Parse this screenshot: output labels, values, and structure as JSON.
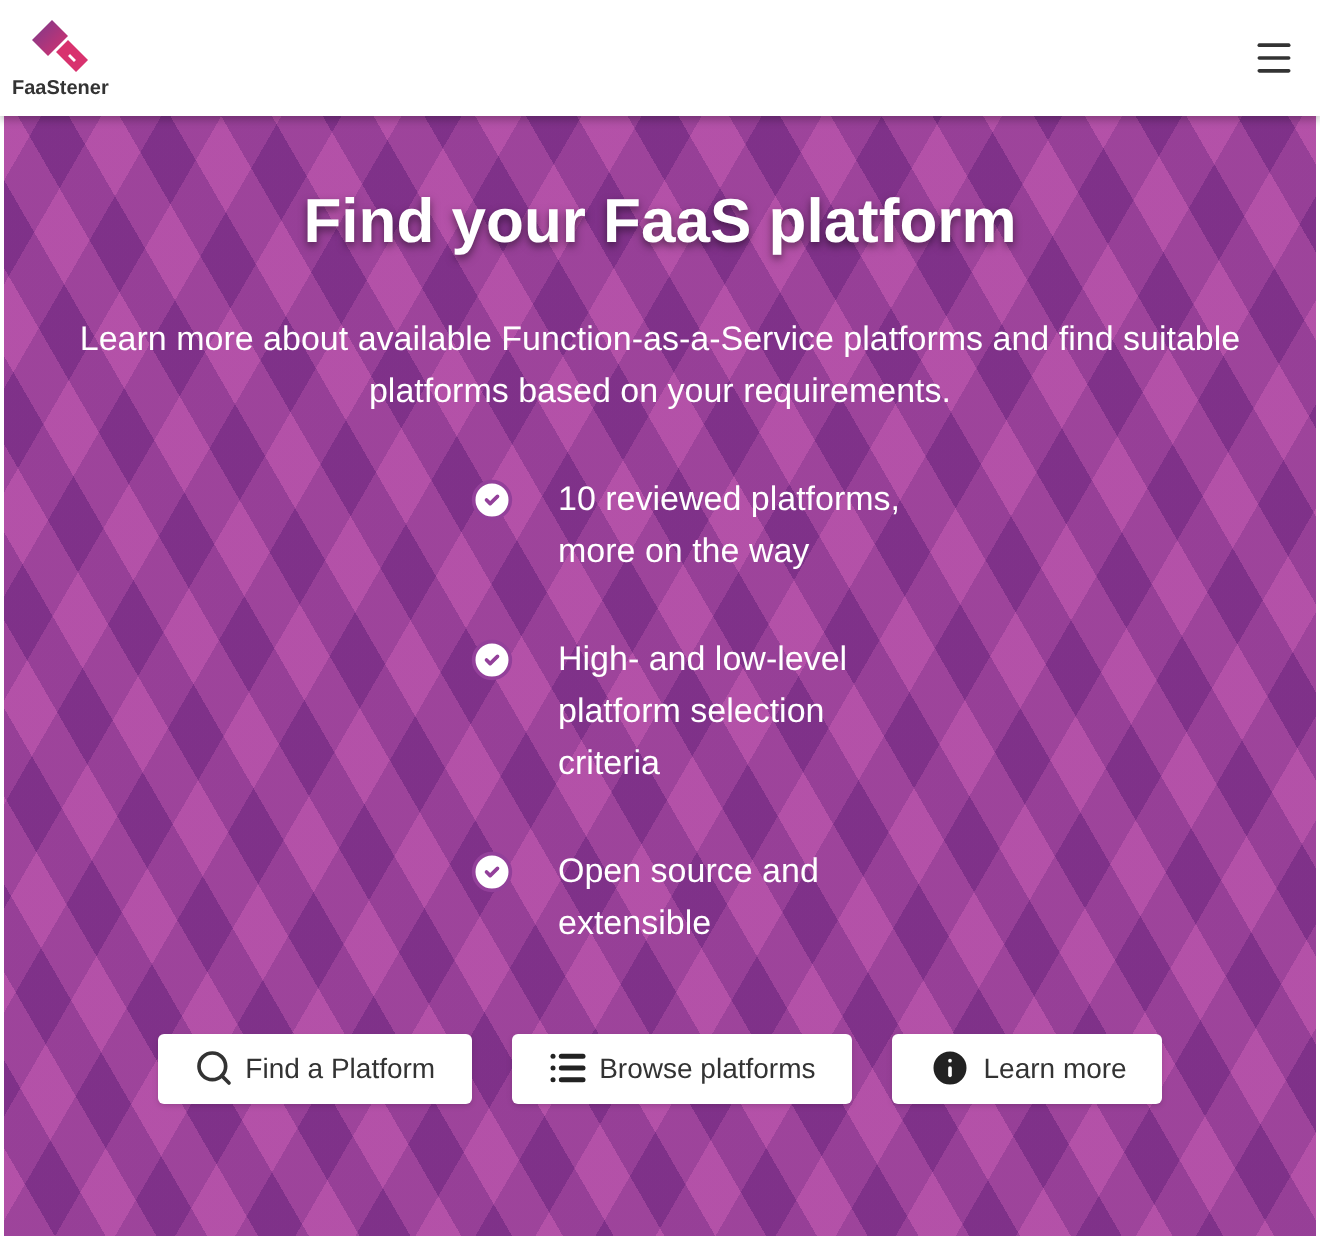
{
  "header": {
    "logo_text": "FaaStener"
  },
  "hero": {
    "title": "Find your FaaS platform",
    "subtitle": "Learn more about available Function-as-a-Service platforms and find suitable platforms based on your requirements.",
    "features": [
      {
        "lines": [
          "10 reviewed platforms,",
          "more on the way"
        ]
      },
      {
        "lines": [
          "High- and low-level",
          "platform selection",
          "criteria"
        ]
      },
      {
        "lines": [
          "Open source and",
          "extensible"
        ]
      }
    ],
    "buttons": [
      {
        "label": "Find a Platform",
        "kind": "search"
      },
      {
        "label": "Browse platforms",
        "kind": "list"
      },
      {
        "label": "Learn more",
        "kind": "info"
      }
    ]
  }
}
